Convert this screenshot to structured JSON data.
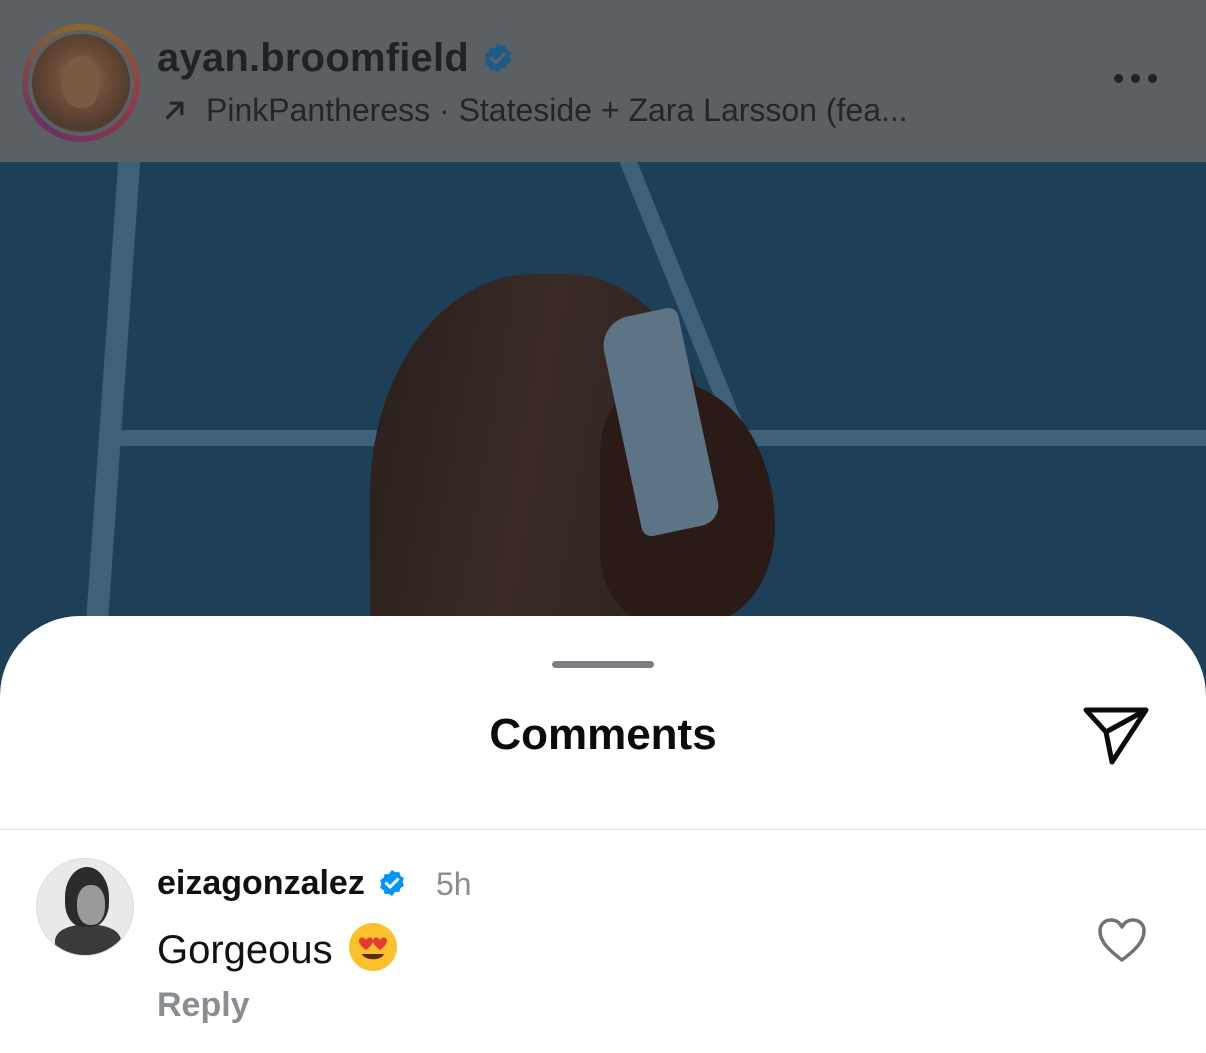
{
  "post": {
    "username": "ayan.broomfield",
    "verified": true,
    "music_label": "PinkPantheress · Stateside + Zara Larsson (fea...",
    "icons": {
      "verified": "verified-badge-icon",
      "music_arrow": "arrow-up-right-icon",
      "more": "more-options-icon"
    }
  },
  "comments_sheet": {
    "title": "Comments",
    "icons": {
      "share": "send-icon"
    },
    "comments": [
      {
        "username": "eizagonzalez",
        "verified": true,
        "time": "5h",
        "text": "Gorgeous",
        "emoji": "heart-eyes-emoji",
        "reply_label": "Reply",
        "like_icon": "heart-outline-icon"
      }
    ]
  },
  "colors": {
    "verified_blue": "#0095f6",
    "muted_text": "#8a8d91",
    "dim_overlay": "#5b6064"
  }
}
